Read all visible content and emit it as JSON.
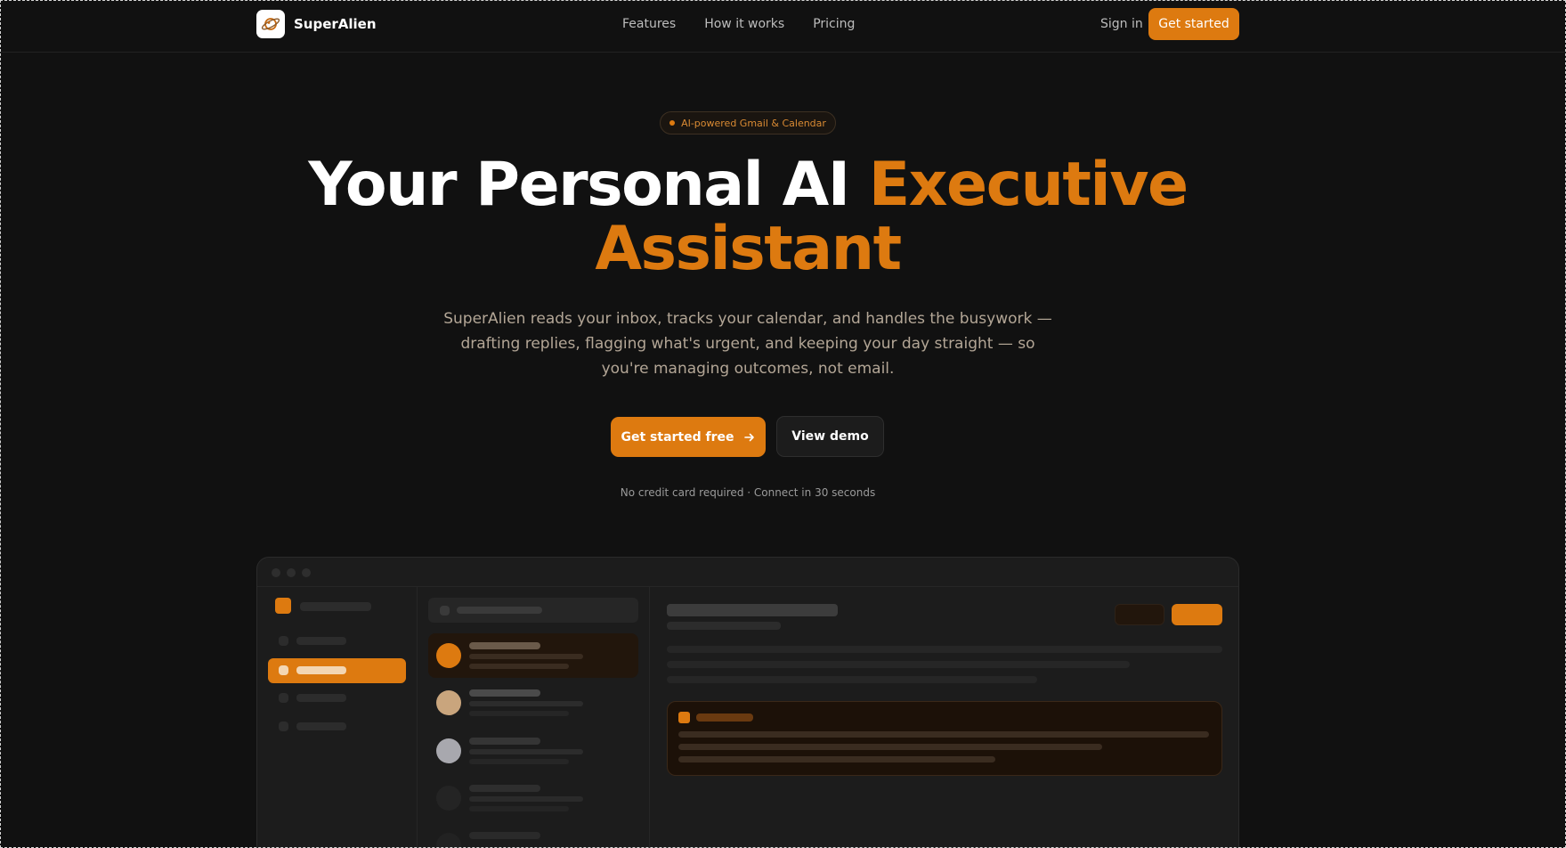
{
  "brand": {
    "name": "SuperAlien",
    "logo_icon": "planet-icon"
  },
  "nav": {
    "links": [
      "Features",
      "How it works",
      "Pricing"
    ],
    "sign_in": "Sign in",
    "cta": "Get started"
  },
  "hero": {
    "badge": "AI-powered Gmail & Calendar",
    "headline_plain": "Your Personal AI ",
    "headline_accent_1": "Executive",
    "headline_accent_2": "Assistant",
    "subtext": "SuperAlien reads your inbox, tracks your calendar, and handles the busywork — drafting replies, flagging what's urgent, and keeping your day straight — so you're managing outcomes, not email.",
    "primary_cta": "Get started free",
    "primary_cta_icon": "arrow-right-icon",
    "secondary_cta": "View demo",
    "fineprint": "No credit card required · Connect in 30 seconds"
  },
  "colors": {
    "accent": "#dd7a10",
    "background": "#111111",
    "muted_text": "#b3a696"
  }
}
